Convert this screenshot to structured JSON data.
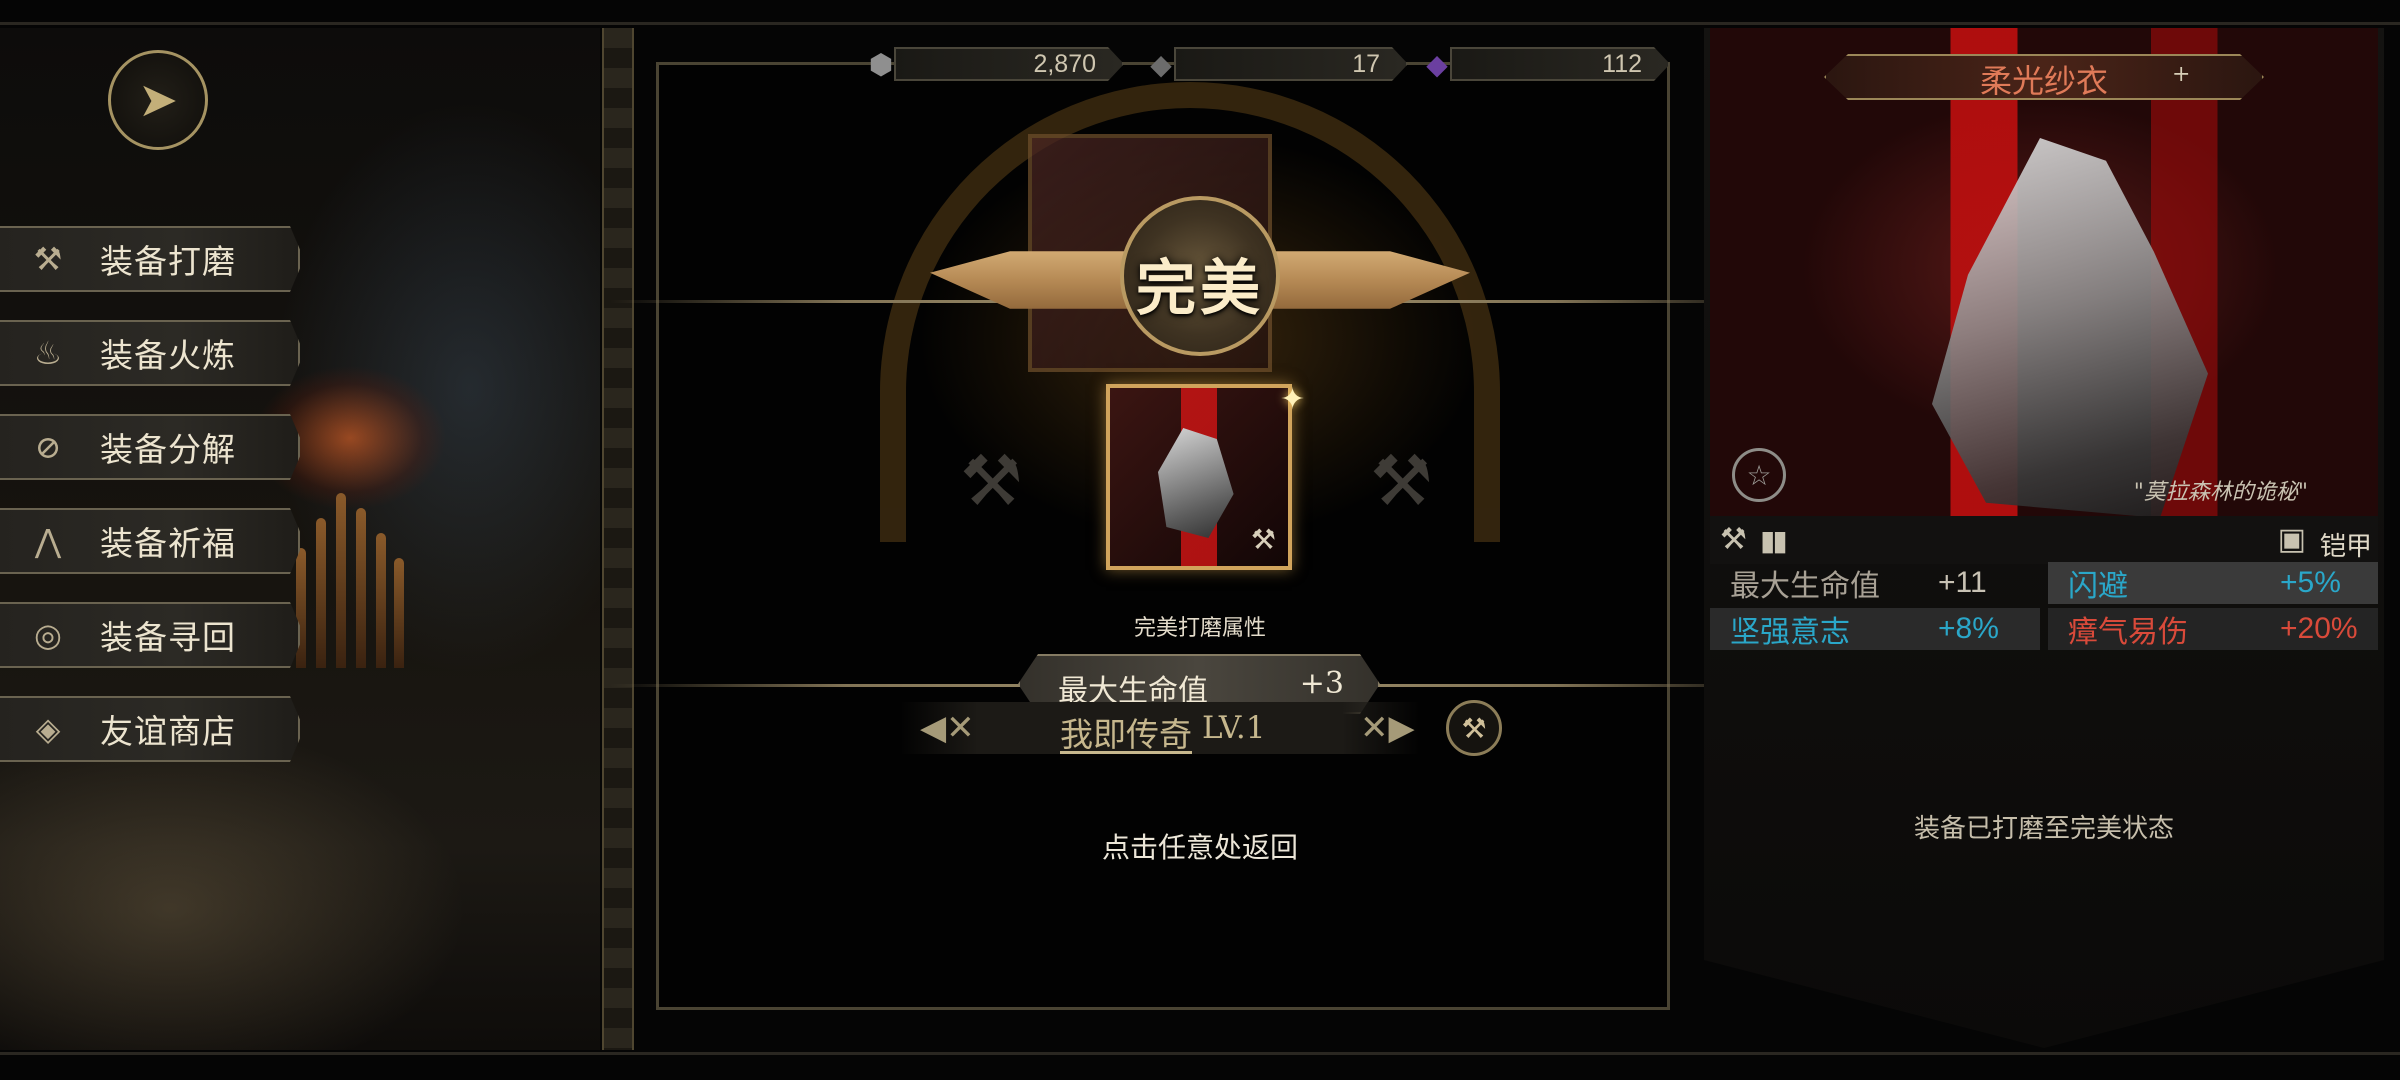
{
  "back_button": {
    "icon": "back-arrow-icon"
  },
  "menu": [
    {
      "label": "装备打磨",
      "icon": "hammer-icon",
      "glyph": "⚒"
    },
    {
      "label": "装备火炼",
      "icon": "flame-icon",
      "glyph": "♨"
    },
    {
      "label": "装备分解",
      "icon": "decompose-icon",
      "glyph": "⊘"
    },
    {
      "label": "装备祈福",
      "icon": "pray-hands-icon",
      "glyph": "⋀"
    },
    {
      "label": "装备寻回",
      "icon": "target-icon",
      "glyph": "◎"
    },
    {
      "label": "友谊商店",
      "icon": "fox-icon",
      "glyph": "◈"
    }
  ],
  "currencies": [
    {
      "icon": "silver-ore-icon",
      "glyph": "⬢",
      "color": "#8f8f8f",
      "value": "2,870"
    },
    {
      "icon": "iron-ore-icon",
      "glyph": "◆",
      "color": "#6c6c6c",
      "value": "17"
    },
    {
      "icon": "purple-crystal-icon",
      "glyph": "◆",
      "color": "#6b3fa0",
      "value": "112"
    }
  ],
  "result": {
    "title": "完美",
    "sub_title": "完美打磨属性",
    "stat_name": "最大生命值",
    "stat_value": "+3",
    "legend_name": "我即传奇",
    "legend_level": "LV.1",
    "return_hint": "点击任意处返回"
  },
  "item": {
    "name": "柔光纱衣",
    "plus": "+",
    "quote": "\"莫拉森林的诡秘\"",
    "slot_label": "铠甲",
    "status": "装备已打磨至完美状态",
    "stats": [
      {
        "name": "最大生命值",
        "value": "+11",
        "name_color": "#a8a195",
        "value_color": "#c8c2b4",
        "bg": "transparent"
      },
      {
        "name": "闪避",
        "value": "+5%",
        "name_color": "#2aa7c9",
        "value_color": "#2aa7c9",
        "bg": "#3a3a3a"
      },
      {
        "name": "坚强意志",
        "value": "+8%",
        "name_color": "#2aa7c9",
        "value_color": "#2aa7c9",
        "bg": "#2a2a2a"
      },
      {
        "name": "瘴气易伤",
        "value": "+20%",
        "name_color": "#d94a3a",
        "value_color": "#d94a3a",
        "bg": "#242424"
      }
    ]
  }
}
